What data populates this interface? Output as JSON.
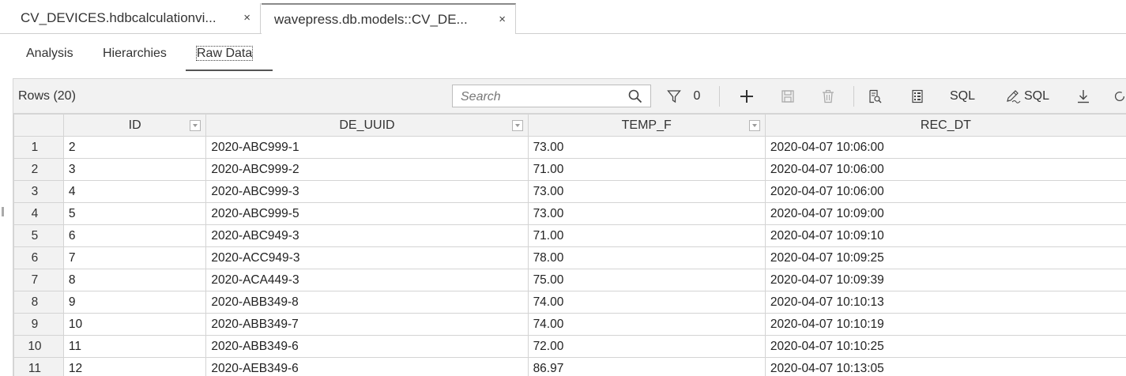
{
  "editor_tabs": [
    {
      "label": "CV_DEVICES.hdbcalculationvi...",
      "close": "×"
    },
    {
      "label": "wavepress.db.models::CV_DE...",
      "close": "×"
    }
  ],
  "view_tabs": [
    "Analysis",
    "Hierarchies",
    "Raw Data"
  ],
  "active_view_tab": "Raw Data",
  "toolbar": {
    "rows_label": "Rows (20)",
    "search_placeholder": "Search",
    "filter_count": "0",
    "sql_label": "SQL",
    "edit_sql_label": "SQL"
  },
  "table": {
    "columns": [
      "ID",
      "DE_UUID",
      "TEMP_F",
      "REC_DT"
    ],
    "rows": [
      {
        "n": "1",
        "id": "2",
        "uuid": "2020-ABC999-1",
        "temp": "73.00",
        "dt": "2020-04-07 10:06:00"
      },
      {
        "n": "2",
        "id": "3",
        "uuid": "2020-ABC999-2",
        "temp": "71.00",
        "dt": "2020-04-07 10:06:00"
      },
      {
        "n": "3",
        "id": "4",
        "uuid": "2020-ABC999-3",
        "temp": "73.00",
        "dt": "2020-04-07 10:06:00"
      },
      {
        "n": "4",
        "id": "5",
        "uuid": "2020-ABC999-5",
        "temp": "73.00",
        "dt": "2020-04-07 10:09:00"
      },
      {
        "n": "5",
        "id": "6",
        "uuid": "2020-ABC949-3",
        "temp": "71.00",
        "dt": "2020-04-07 10:09:10"
      },
      {
        "n": "6",
        "id": "7",
        "uuid": "2020-ACC949-3",
        "temp": "78.00",
        "dt": "2020-04-07 10:09:25"
      },
      {
        "n": "7",
        "id": "8",
        "uuid": "2020-ACA449-3",
        "temp": "75.00",
        "dt": "2020-04-07 10:09:39"
      },
      {
        "n": "8",
        "id": "9",
        "uuid": "2020-ABB349-8",
        "temp": "74.00",
        "dt": "2020-04-07 10:10:13"
      },
      {
        "n": "9",
        "id": "10",
        "uuid": "2020-ABB349-7",
        "temp": "74.00",
        "dt": "2020-04-07 10:10:19"
      },
      {
        "n": "10",
        "id": "11",
        "uuid": "2020-ABB349-6",
        "temp": "72.00",
        "dt": "2020-04-07 10:10:25"
      },
      {
        "n": "11",
        "id": "12",
        "uuid": "2020-AEB349-6",
        "temp": "86.97",
        "dt": "2020-04-07 10:13:05"
      }
    ]
  }
}
